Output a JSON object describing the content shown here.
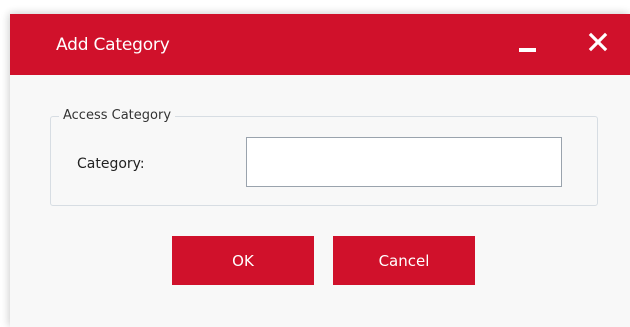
{
  "dialog": {
    "title": "Add Category",
    "minimize_icon": "minimize-icon",
    "close_icon": "close-icon"
  },
  "group": {
    "legend": "Access Category",
    "category_label": "Category:",
    "category_value": "",
    "category_placeholder": ""
  },
  "buttons": {
    "ok_label": "OK",
    "cancel_label": "Cancel"
  },
  "colors": {
    "accent": "#d0112b",
    "background": "#f8f8f8",
    "border": "#d7dde3"
  }
}
